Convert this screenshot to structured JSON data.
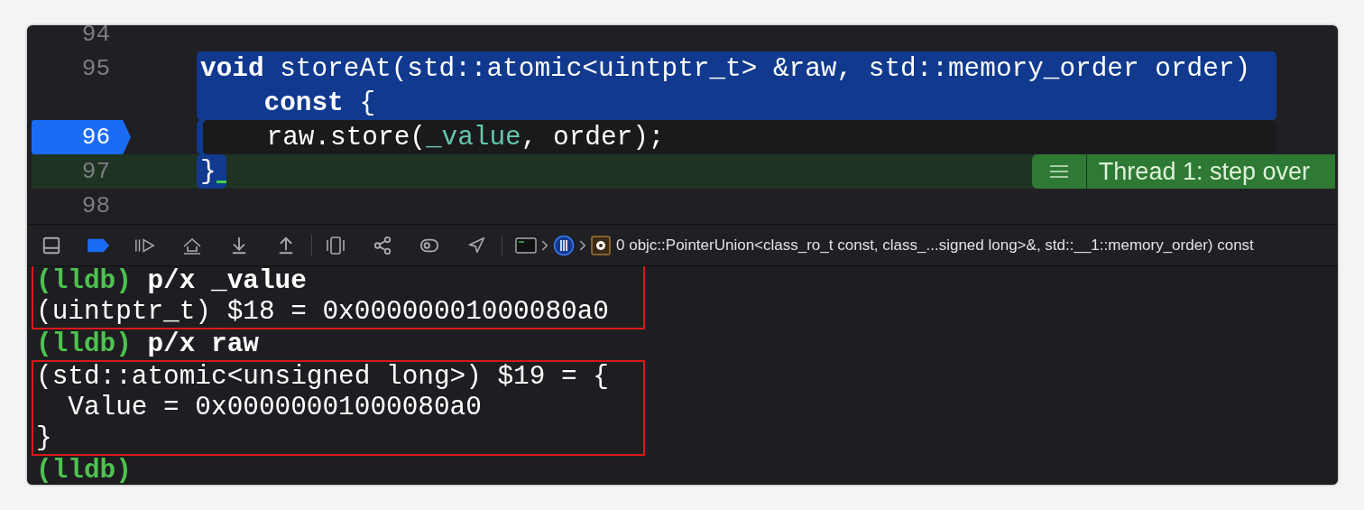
{
  "editor": {
    "lines": [
      {
        "number": "94",
        "selected": false,
        "breakpoint": false,
        "current": false
      },
      {
        "number": "95",
        "selected": true,
        "breakpoint": false,
        "current": false,
        "code": [
          [
            {
              "text": "void",
              "kind": "keyword"
            },
            {
              "text": " storeAt(std::atomic<uintptr_t> &raw, std::memory_order order)",
              "kind": "plain"
            }
          ],
          [
            {
              "text": "    const",
              "kind": "keyword"
            },
            {
              "text": " {",
              "kind": "plain"
            }
          ]
        ]
      },
      {
        "number": "96",
        "selected": true,
        "breakpoint": true,
        "current": false,
        "code": [
          [
            {
              "text": "    raw.store(",
              "kind": "plain"
            },
            {
              "text": "_value",
              "kind": "variable"
            },
            {
              "text": ", order);",
              "kind": "plain"
            }
          ]
        ]
      },
      {
        "number": "97",
        "selected": true,
        "breakpoint": false,
        "current": true,
        "cursor": true,
        "annotation": "Thread 1: step over",
        "code": [
          [
            {
              "text": "}",
              "kind": "plain"
            }
          ]
        ]
      },
      {
        "number": "98",
        "selected": false,
        "breakpoint": false,
        "current": false
      }
    ]
  },
  "debug_bar": {
    "breakpoints_active": true,
    "frame_label": "0 objc::PointerUnion<class_ro_t const, class_...signed long>&, std::__1::memory_order) const"
  },
  "console": {
    "groups": [
      {
        "boxed": true,
        "lines": [
          {
            "kind": "command",
            "prompt": "(lldb)",
            "command": "p/x _value"
          },
          {
            "kind": "output",
            "text": "(uintptr_t) $18 = 0x00000001000080a0"
          }
        ]
      },
      {
        "boxed": false,
        "lines": [
          {
            "kind": "command",
            "prompt": "(lldb)",
            "command": "p/x raw"
          }
        ]
      },
      {
        "boxed": true,
        "lines": [
          {
            "kind": "output",
            "text": "(std::atomic<unsigned long>) $19 = {"
          },
          {
            "kind": "output",
            "text": "  Value = 0x00000001000080a0"
          },
          {
            "kind": "output",
            "text": "}"
          }
        ]
      },
      {
        "boxed": false,
        "lines": [
          {
            "kind": "command",
            "prompt": "(lldb)"
          }
        ]
      }
    ]
  }
}
